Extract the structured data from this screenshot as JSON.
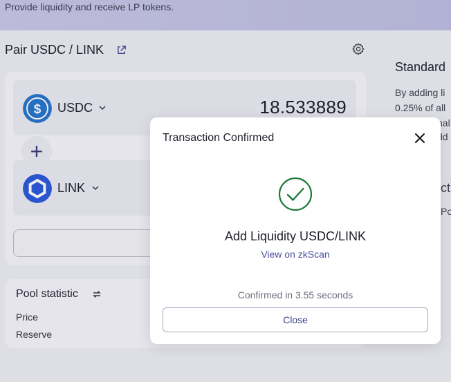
{
  "header": {
    "subtitle": "Provide liquidity and receive LP tokens."
  },
  "pair": {
    "title": "Pair USDC / LINK",
    "external_icon": "external-link-icon",
    "settings_icon": "gear-icon"
  },
  "tokens": [
    {
      "symbol": "USDC",
      "amount": "18.533889",
      "icon": "usdc-logo-icon",
      "color": "#2775ca"
    },
    {
      "symbol": "LINK",
      "amount": "",
      "icon": "chainlink-logo-icon",
      "color": "#2a5ada"
    }
  ],
  "plus_label": "+",
  "right_panel": {
    "title": "Standard",
    "line1": "By adding li",
    "line2": "0.25% of all",
    "line3": "nal",
    "line4": "dd",
    "line5": "cti",
    "line6": "Poo"
  },
  "pool_statistic": {
    "title": "Pool statistic",
    "price_label": "Price",
    "reserve_label": "Reserve"
  },
  "modal": {
    "title": "Transaction Confirmed",
    "heading": "Add Liquidity USDC/LINK",
    "link": "View on zkScan",
    "confirmed": "Confirmed in 3.55 seconds",
    "close_label": "Close",
    "success_color": "#1e7a3a"
  }
}
